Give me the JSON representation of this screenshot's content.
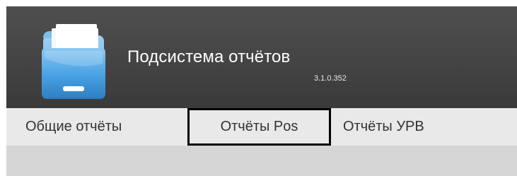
{
  "app": {
    "title": "Подсистема отчётов",
    "version": "3.1.0.352",
    "icon": "folder-reports-icon"
  },
  "tabs": [
    {
      "label": "Общие отчёты"
    },
    {
      "label": "Отчёты Pos",
      "highlighted": true
    },
    {
      "label": "Отчёты УРВ"
    }
  ],
  "colors": {
    "header_bg": "#444444",
    "tabbar_bg": "#e9e9e9",
    "content_bg": "#d5d5d5",
    "tab_text": "#333333",
    "highlight_border": "#000000"
  }
}
